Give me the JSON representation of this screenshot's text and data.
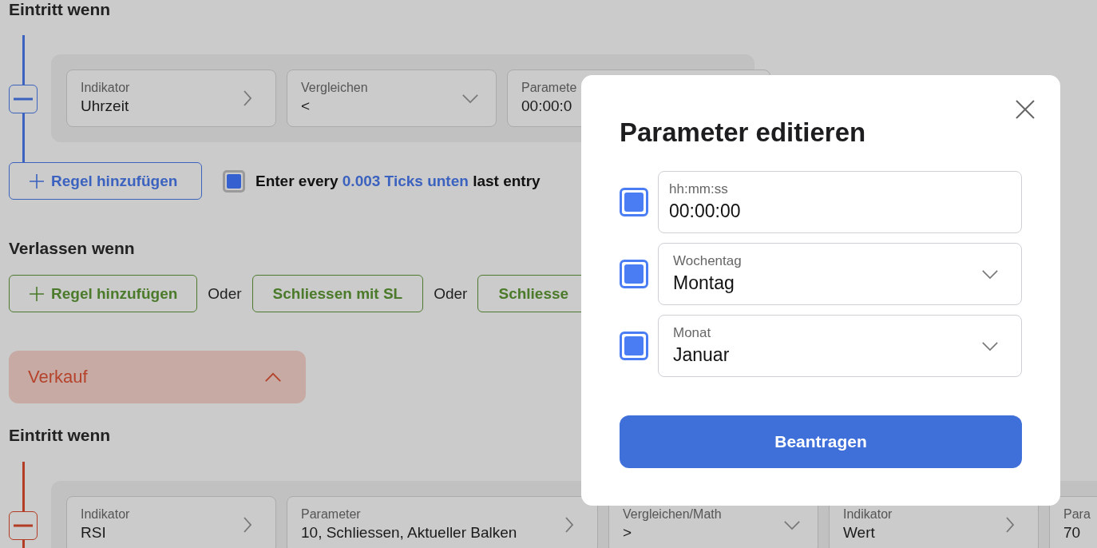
{
  "buy_entry": {
    "heading": "Eintritt wenn",
    "conditions": [
      {
        "kind": "selector",
        "label": "Indikator",
        "value": "Uhrzeit"
      },
      {
        "kind": "dropdown",
        "label": "Vergleichen",
        "value": "<"
      },
      {
        "kind": "input",
        "label": "Paramete",
        "value": "00:00:0"
      }
    ],
    "add_rule_button": "Regel hinzufügen",
    "repeat_entry": {
      "checked": true,
      "parts": [
        {
          "kind": "plain",
          "text": "Enter every"
        },
        {
          "kind": "link",
          "text": "0.003 Ticks unten"
        },
        {
          "kind": "plain",
          "text": "last entry"
        }
      ]
    }
  },
  "buy_exit": {
    "heading": "Verlassen wenn",
    "items": [
      {
        "kind": "add",
        "label": "Regel hinzufügen"
      },
      {
        "kind": "separator",
        "label": "Oder"
      },
      {
        "kind": "action",
        "label": "Schliessen mit SL"
      },
      {
        "kind": "separator",
        "label": "Oder"
      },
      {
        "kind": "action",
        "label": "Schliesse"
      }
    ]
  },
  "sell_panel": {
    "label": "Verkauf",
    "expanded": true
  },
  "sell_entry": {
    "heading": "Eintritt wenn",
    "conditions": [
      {
        "kind": "selector",
        "label": "Indikator",
        "value": "RSI"
      },
      {
        "kind": "selector",
        "label": "Parameter",
        "value": "10, Schliessen, Aktueller Balken"
      },
      {
        "kind": "dropdown",
        "label": "Vergleichen/Math",
        "value": ">"
      },
      {
        "kind": "selector",
        "label": "Indikator",
        "value": "Wert"
      },
      {
        "kind": "input",
        "label": "Para",
        "value": "70"
      }
    ]
  },
  "dialog": {
    "title": "Parameter editieren",
    "options": [
      {
        "checked": true,
        "kind": "input",
        "label": "hh:mm:ss",
        "value": "00:00:00"
      },
      {
        "checked": true,
        "kind": "dropdown",
        "label": "Wochentag",
        "value": "Montag"
      },
      {
        "checked": true,
        "kind": "dropdown",
        "label": "Monat",
        "value": "Januar"
      }
    ],
    "submit_button": "Beantragen"
  }
}
